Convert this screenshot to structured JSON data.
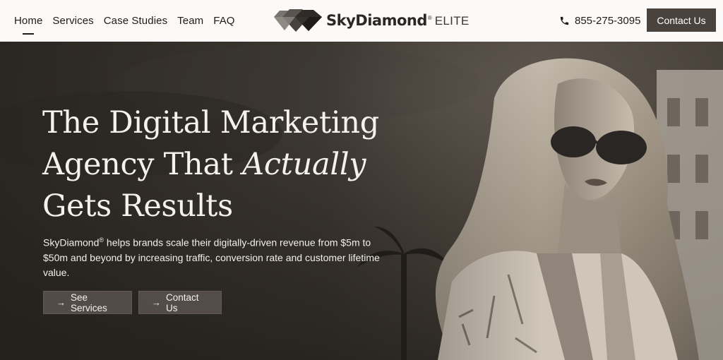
{
  "nav": {
    "items": [
      {
        "label": "Home",
        "active": true
      },
      {
        "label": "Services",
        "active": false
      },
      {
        "label": "Case Studies",
        "active": false
      },
      {
        "label": "Team",
        "active": false
      },
      {
        "label": "FAQ",
        "active": false
      }
    ]
  },
  "logo": {
    "wordmark": "SkyDiamond",
    "registered": "®",
    "suffix": "ELITE",
    "icon": "diamond-logo-icon"
  },
  "header": {
    "phone": "855-275-3095",
    "phone_icon": "phone-icon",
    "contact_label": "Contact Us"
  },
  "hero": {
    "headline_line1": "The Digital Marketing",
    "headline_line2_plain": "Agency That ",
    "headline_line2_italic": "Actually",
    "headline_line3": "Gets Results",
    "subcopy_brand": "SkyDiamond",
    "subcopy_reg": "®",
    "subcopy_rest": " helps brands scale their digitally-driven revenue from $5m to $50m and beyond by increasing traffic, conversion rate and customer lifetime value.",
    "buttons": [
      {
        "arrow": "→",
        "label": "See Services"
      },
      {
        "arrow": "→",
        "label": "Contact Us"
      }
    ]
  },
  "colors": {
    "header_bg": "#fbfaf8",
    "text_dark": "#1e1c1a",
    "contact_button": "#4a423c",
    "hero_overlay": "#221f1b",
    "hero_text": "#f5f2ee"
  }
}
